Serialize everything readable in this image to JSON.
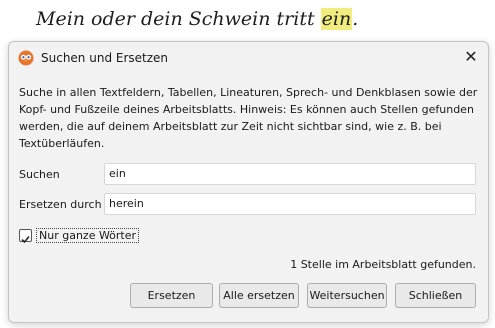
{
  "document": {
    "text_before": "Mein oder dein Schwein tritt ",
    "highlight": "ein",
    "text_after": ".",
    "highlight_color": "#f0ec7e"
  },
  "dialog": {
    "title": "Suchen und Ersetzen",
    "close_glyph": "✕",
    "description": "Suche in allen Textfeldern, Tabellen, Lineaturen, Sprech- und Denkblasen sowie der Kopf- und Fußzeile deines Arbeitsblatts. Hinweis: Es können auch Stellen gefunden werden, die auf deinem Arbeitsblatt zur Zeit nicht sichtbar sind, wie z. B. bei Textüberläufen.",
    "search_label": "Suchen",
    "search_value": "ein",
    "replace_label": "Ersetzen durch",
    "replace_value": "herein",
    "whole_words_label": "Nur ganze Wörter",
    "whole_words_checked": true,
    "status": "1 Stelle im Arbeitsblatt gefunden.",
    "buttons": {
      "replace": "Ersetzen",
      "replace_all": "Alle ersetzen",
      "find_next": "Weitersuchen",
      "close": "Schließen"
    }
  }
}
